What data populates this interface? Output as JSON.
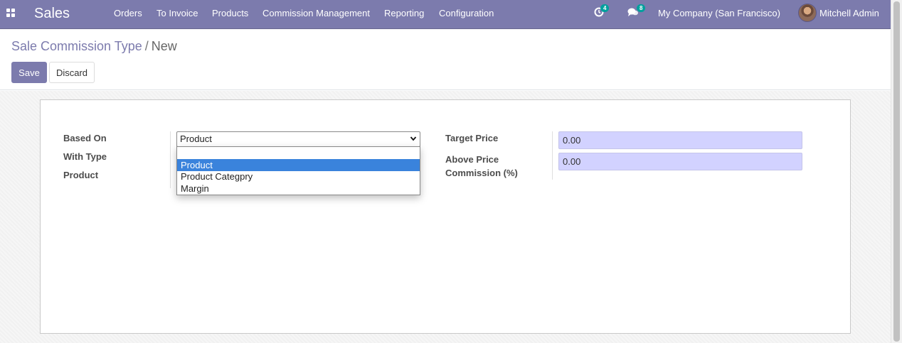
{
  "navbar": {
    "app_name": "Sales",
    "menu": [
      "Orders",
      "To Invoice",
      "Products",
      "Commission Management",
      "Reporting",
      "Configuration"
    ],
    "activity_count": "4",
    "message_count": "8",
    "company": "My Company (San Francisco)",
    "user": "Mitchell Admin",
    "bg_color": "#7c7bad"
  },
  "breadcrumb": {
    "parent": "Sale Commission Type",
    "separator": "/",
    "current": "New"
  },
  "buttons": {
    "save": "Save",
    "discard": "Discard"
  },
  "form": {
    "based_on_label": "Based On",
    "with_type_label": "With Type",
    "product_label": "Product",
    "based_on_value": "Product",
    "based_on_options": [
      "",
      "Product",
      "Product Categpry",
      "Margin"
    ],
    "selected_option_index": 1,
    "target_price_label": "Target Price",
    "target_price_value": "0.00",
    "above_price_label_line1": "Above Price",
    "above_price_label_line2": "Commission (%)",
    "above_price_value": "0.00"
  }
}
